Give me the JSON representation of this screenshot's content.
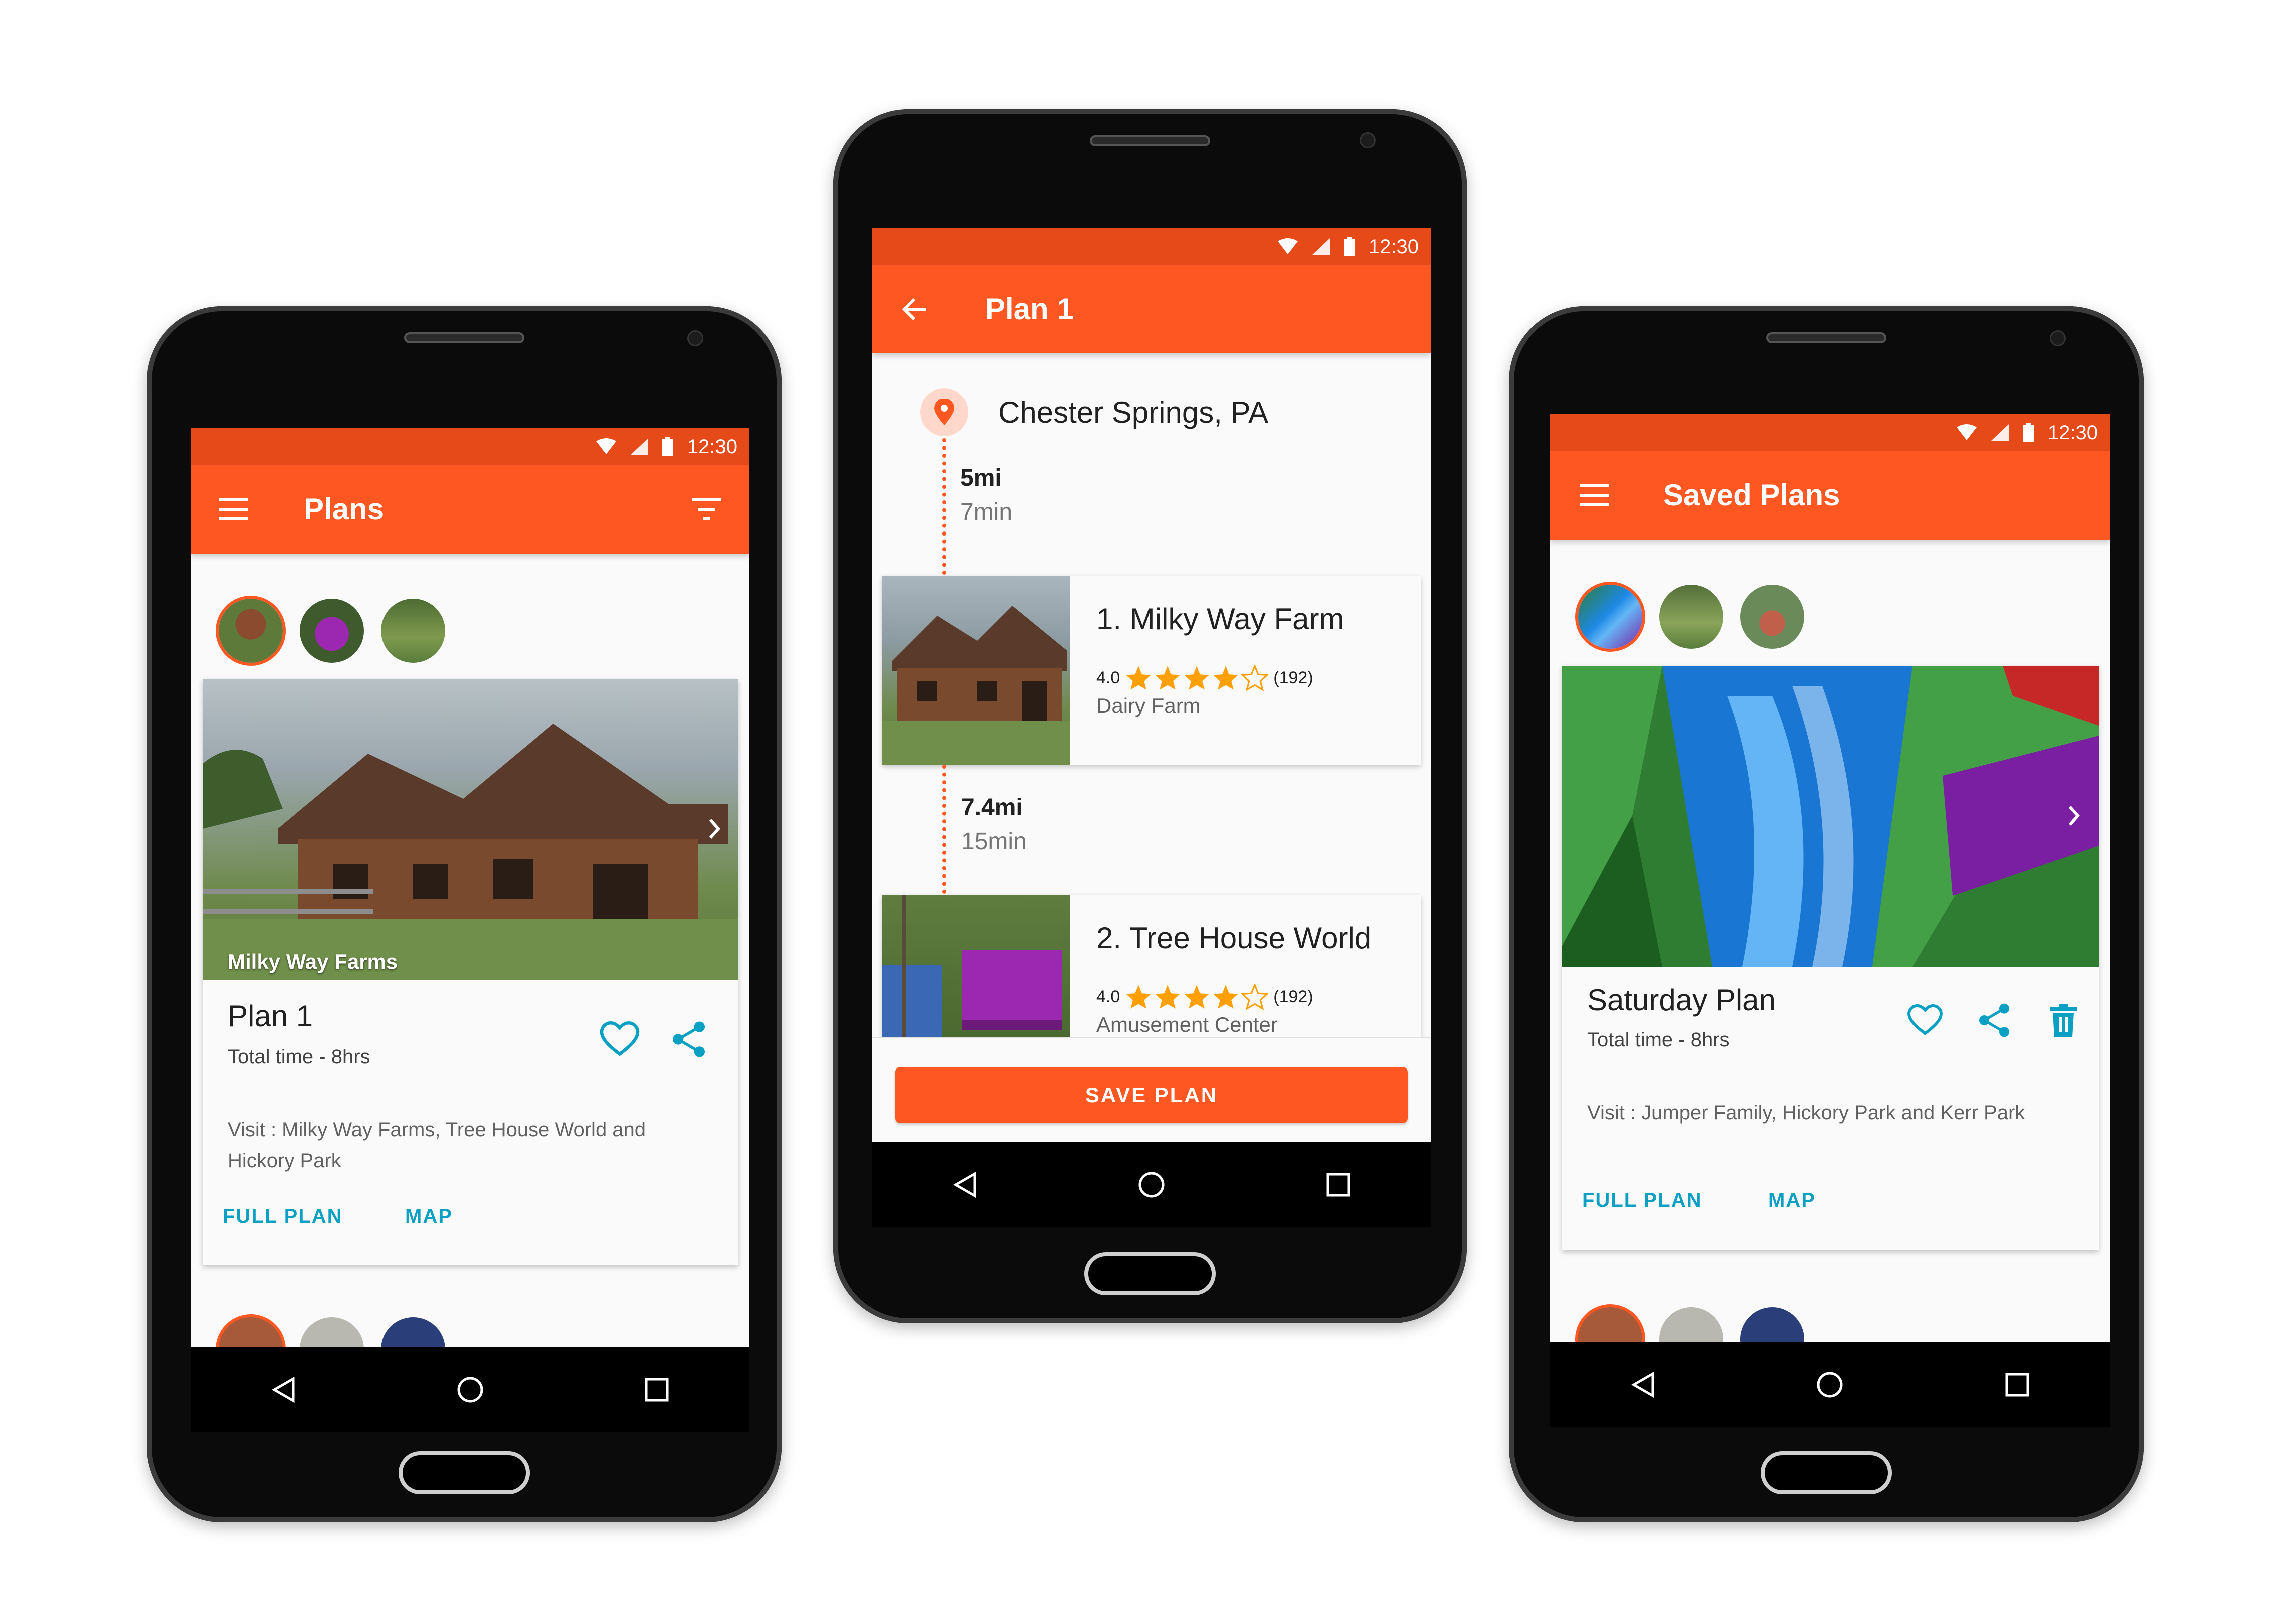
{
  "colors": {
    "primary": "#ff5722",
    "status": "#e64a19",
    "accent": "#0aa0c4",
    "star": "#ffa000"
  },
  "status_time": "12:30",
  "plans_screen": {
    "title": "Plans",
    "card": {
      "image_caption": "Milky Way Farms",
      "title": "Plan 1",
      "total_time": "Total time - 8hrs",
      "visit": "Visit : Milky Way Farms, Tree House World and Hickory Park",
      "full_plan_label": "FULL PLAN",
      "map_label": "MAP"
    }
  },
  "plan_detail_screen": {
    "title": "Plan 1",
    "start_location": "Chester Springs, PA",
    "legs": [
      {
        "distance": "5mi",
        "duration": "7min"
      },
      {
        "distance": "7.4mi",
        "duration": "15min"
      }
    ],
    "places": [
      {
        "name": "1. Milky Way Farm",
        "rating": "4.0",
        "stars": 4,
        "reviews": "(192)",
        "category": "Dairy Farm"
      },
      {
        "name": "2. Tree House World",
        "rating": "4.0",
        "stars": 4,
        "reviews": "(192)",
        "category": "Amusement Center"
      }
    ],
    "save_label": "SAVE PLAN"
  },
  "saved_plans_screen": {
    "title": "Saved Plans",
    "card": {
      "title": "Saturday Plan",
      "total_time": "Total time - 8hrs",
      "visit": "Visit : Jumper Family, Hickory Park and Kerr Park",
      "full_plan_label": "FULL PLAN",
      "map_label": "MAP"
    }
  },
  "icons": [
    "menu-icon",
    "filter-icon",
    "back-arrow-icon",
    "heart-icon",
    "share-icon",
    "delete-icon",
    "location-pin-icon",
    "star-icon",
    "chevron-right-icon",
    "wifi-icon",
    "signal-icon",
    "battery-icon",
    "nav-back-icon",
    "nav-home-icon",
    "nav-recents-icon"
  ]
}
